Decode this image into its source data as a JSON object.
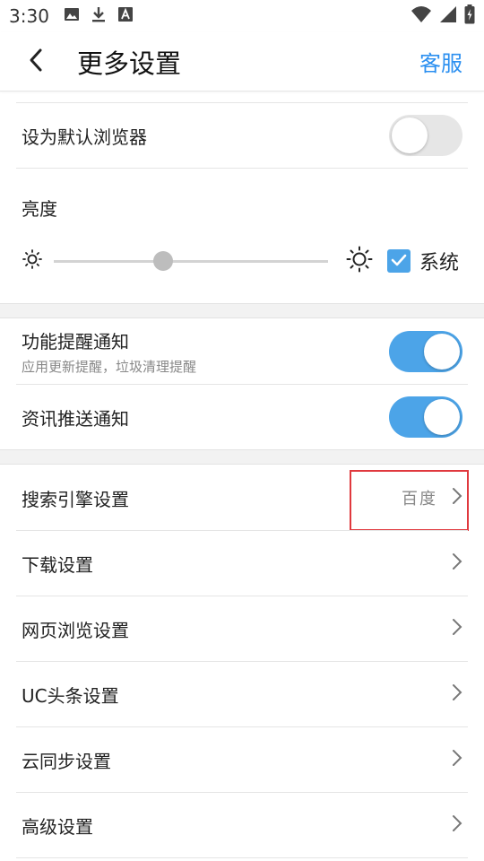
{
  "status_bar": {
    "time": "3:30",
    "icons_left": [
      "image-icon",
      "download-icon",
      "font-icon"
    ],
    "icons_right": [
      "wifi-icon",
      "signal-icon",
      "battery-icon"
    ]
  },
  "header": {
    "back_icon": "chevron-left-icon",
    "title": "更多设置",
    "service_label": "客服",
    "accent_color": "#2b8ff0"
  },
  "settings": {
    "default_browser": {
      "label": "设为默认浏览器",
      "toggle_on": false
    },
    "brightness": {
      "label": "亮度",
      "level_fraction": 0.4,
      "system_label": "系统",
      "system_checked": true
    },
    "feature_notify": {
      "label": "功能提醒通知",
      "sublabel": "应用更新提醒，垃圾清理提醒",
      "toggle_on": true
    },
    "news_push": {
      "label": "资讯推送通知",
      "toggle_on": true
    }
  },
  "menu": {
    "search_engine": {
      "label": "搜索引擎设置",
      "value": "百度"
    },
    "download": {
      "label": "下载设置"
    },
    "web_browsing": {
      "label": "网页浏览设置"
    },
    "uc_headlines": {
      "label": "UC头条设置"
    },
    "cloud_sync": {
      "label": "云同步设置"
    },
    "advanced": {
      "label": "高级设置"
    }
  },
  "colors": {
    "toggle_on": "#4ca4e8",
    "toggle_off": "#e6e6e6",
    "highlight": "#e0393e"
  }
}
